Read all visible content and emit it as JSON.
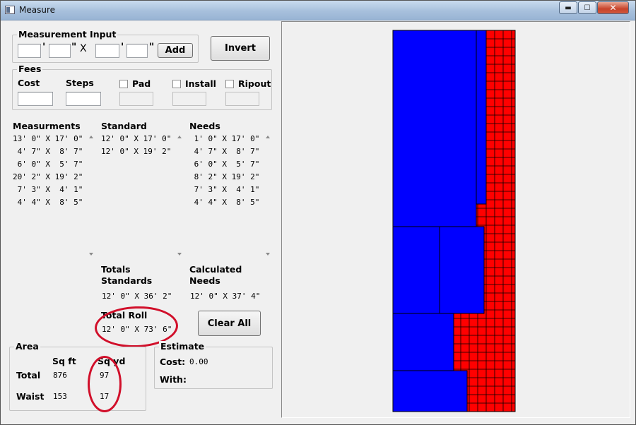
{
  "window": {
    "title": "Measure",
    "controls": {
      "minimize": "▬",
      "maximize": "☐",
      "close": "✕"
    }
  },
  "measurement_input": {
    "title": "Measurement Input",
    "feet_mark": "'",
    "inch_mark": "\"",
    "times": "X",
    "fields": [
      "",
      "",
      "",
      ""
    ],
    "add_label": "Add"
  },
  "invert_label": "Invert",
  "fees": {
    "title": "Fees",
    "cost_label": "Cost",
    "cost_value": "",
    "steps_label": "Steps",
    "steps_value": "",
    "pad_label": "Pad",
    "install_label": "Install",
    "ripout_label": "Ripout",
    "pad_checked": false,
    "install_checked": false,
    "ripout_checked": false
  },
  "lists": {
    "measurements": {
      "header": "Measurments",
      "items": [
        "13' 0\" X 17' 0\"",
        " 4' 7\" X  8' 7\"",
        " 6' 0\" X  5' 7\"",
        "20' 2\" X 19' 2\"",
        " 7' 3\" X  4' 1\"",
        " 4' 4\" X  8' 5\""
      ]
    },
    "standard": {
      "header": "Standard",
      "items": [
        "12' 0\" X 17' 0\"",
        "12' 0\" X 19' 2\""
      ]
    },
    "needs": {
      "header": "Needs",
      "items": [
        " 1' 0\" X 17' 0\"",
        " 4' 7\" X  8' 7\"",
        " 6' 0\" X  5' 7\"",
        " 8' 2\" X 19' 2\"",
        " 7' 3\" X  4' 1\"",
        " 4' 4\" X  8' 5\""
      ]
    }
  },
  "totals": {
    "standards_label_1": "Totals",
    "standards_label_2": "Standards",
    "standards_value": "12' 0\" X 36' 2\"",
    "calculated_label_1": "Calculated",
    "calculated_label_2": "Needs",
    "calculated_value": "12' 0\" X 37' 4\"",
    "total_roll_label": "Total Roll",
    "total_roll_value": "12' 0\" X 73' 6\""
  },
  "clear_all_label": "Clear All",
  "area": {
    "title": "Area",
    "sqft_header": "Sq ft",
    "sqyd_header": "Sq yd",
    "total_label": "Total",
    "total_sqft": "876",
    "total_sqyd": "97",
    "waist_label": "Waist",
    "waist_sqft": "153",
    "waist_sqyd": "17"
  },
  "estimate": {
    "title": "Estimate",
    "cost_label": "Cost:",
    "cost_value": "0.00",
    "with_label": "With:",
    "with_value": ""
  },
  "colors": {
    "piece_fill": "#0000ff",
    "waste_fill": "#ff0000",
    "grid_line": "#000000",
    "annotation": "#d10f2a"
  }
}
